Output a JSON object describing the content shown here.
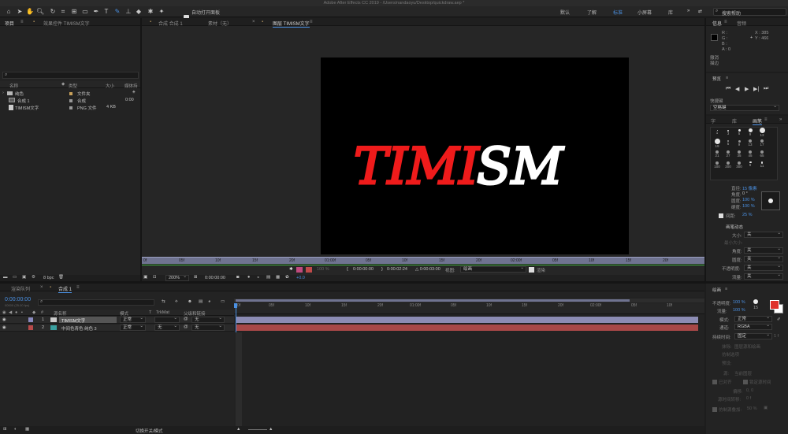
{
  "window": {
    "title": "Adobe After Effects CC 2019 - /Users/nandaoyu/Desktop/quickdraw.aep *"
  },
  "toolbar": {
    "auto_open_panel": "自动打开面板",
    "workspaces": [
      "默认",
      "了解",
      "标准",
      "小屏幕",
      "库"
    ],
    "active_workspace": "标准",
    "search_placeholder": "搜索帮助"
  },
  "project_panel": {
    "tab_project": "项目",
    "tab_effects": "效果控件 TIMISM文字",
    "columns": {
      "name": "名称",
      "type": "类型",
      "size": "大小",
      "media": "媒体持"
    },
    "items": [
      {
        "name": "纯色",
        "type": "文件夹",
        "size": "",
        "color": "#c9a15a"
      },
      {
        "name": "合成 1",
        "type": "合成",
        "size": "0:00",
        "color": "#9a9a9a"
      },
      {
        "name": "TIMISM文字",
        "type": "PNG 文件",
        "size": "4 KB",
        "color": "#9a9a9a"
      }
    ],
    "bpc": "8 bpc"
  },
  "viewer": {
    "tab_comp": "合成 合成 1",
    "tab_footage": "素材（无）",
    "tab_layer": "图层 TIMISM文字",
    "canvas_text_red": "TIMI",
    "canvas_text_white": "SM",
    "ruler_labels": [
      "0f",
      "05f",
      "10f",
      "15f",
      "20f",
      "01:00f",
      "05f",
      "10f",
      "15f",
      "20f",
      "02:00f",
      "05f",
      "10f",
      "15f",
      "20f"
    ],
    "zoom": "200%",
    "timecode_current": "0:00:00:00",
    "opacity": "100 %",
    "in_point": "0:00:00:00",
    "duration": "0:00:02:24",
    "out_point": "△ 0:00:03:00",
    "view_label": "视图:",
    "view_value": "绘画",
    "render_label": "渲染",
    "offset": "+0.0"
  },
  "info_panel": {
    "tab_info": "信息",
    "tab_audio": "音频",
    "r": "R :",
    "g": "G :",
    "b": "B :",
    "a": "A : 0",
    "x": "X : 385",
    "y": "Y : 466",
    "undo": "撤消",
    "stroke": "描边"
  },
  "preview_panel": {
    "title": "预览",
    "shortcut_label": "快捷键",
    "shortcut_value": "空格键"
  },
  "brushes_panel": {
    "tab_char": "字",
    "tab_library": "库",
    "tab_brushes": "画笔",
    "sizes": [
      "1",
      "3",
      "5",
      "9",
      "13",
      "19",
      "5",
      "9",
      "13",
      "17",
      "21",
      "27",
      "35",
      "45",
      "65",
      "100",
      "200",
      "300",
      "9",
      "11"
    ],
    "diameter_label": "直径:",
    "diameter_value": "15 像素",
    "angle_label": "角度:",
    "angle_value": "0 °",
    "roundness_label": "圆度:",
    "roundness_value": "100 %",
    "hardness_label": "硬度:",
    "hardness_value": "100 %",
    "spacing_label": "间距:",
    "spacing_value": "25 %",
    "dynamics_title": "画笔动态",
    "size_label": "大小:",
    "size_value": "关",
    "min_size_label": "最小大小:",
    "angle2_label": "角度:",
    "angle2_value": "关",
    "roundness2_label": "圆度:",
    "roundness2_value": "关",
    "opacity_label": "不透明度:",
    "opacity_value": "关",
    "flow_label": "流量:",
    "flow_value": "关"
  },
  "paint_panel": {
    "title": "绘画",
    "opacity_label": "不透明度:",
    "opacity_value": "100 %",
    "flow_label": "流量:",
    "flow_value": "100 %",
    "mode_label": "模式:",
    "mode_value": "正常",
    "channel_label": "通道:",
    "channel_value": "RGBA",
    "duration_label": "持续时间:",
    "duration_value": "固定",
    "erase_label": "抹除:",
    "erase_value": "图层源和绘画",
    "clone_label": "仿制选项",
    "preset_label": "预设:",
    "source_label": "源:",
    "source_value": "当前图层",
    "align_label": "已对齐",
    "lock_label": "锁定源时间",
    "offset_label": "偏移:",
    "offset_value": "0, 0",
    "src_time_label": "源时间转移:",
    "src_time_value": "0 f",
    "overlay_label": "仿制源叠加:",
    "overlay_value": "50 %",
    "fg_color": "#e0312a",
    "bg_color": "#ffffff",
    "flow_icon_value": "15"
  },
  "timeline": {
    "tab_render": "渲染队列",
    "tab_comp": "合成 1",
    "timecode": "0:00:00:00",
    "timecode_sub": "00000 (25.00 fps)",
    "columns": {
      "num": "#",
      "name": "源名称",
      "mode": "模式",
      "t": "T",
      "trkmat": "TrkMat",
      "parent": "父级和链接"
    },
    "layers": [
      {
        "num": "1",
        "name": "TIMISM文字",
        "mode": "正常",
        "trkmat": "",
        "parent": "无",
        "color": "#8a8ac0"
      },
      {
        "num": "2",
        "name": "中间色青色 纯色 3",
        "mode": "正常",
        "trkmat": "无",
        "parent": "无",
        "color": "#3aa0a0"
      }
    ],
    "ruler_labels": [
      "0f",
      "05f",
      "10f",
      "15f",
      "20f",
      "01:00f",
      "05f",
      "10f",
      "15f",
      "20f",
      "02:00f",
      "05f",
      "10f"
    ],
    "switch_mode": "切换开关/模式",
    "layer1_bar_color": "#8c8cb4",
    "layer2_bar_color": "#a84848"
  }
}
